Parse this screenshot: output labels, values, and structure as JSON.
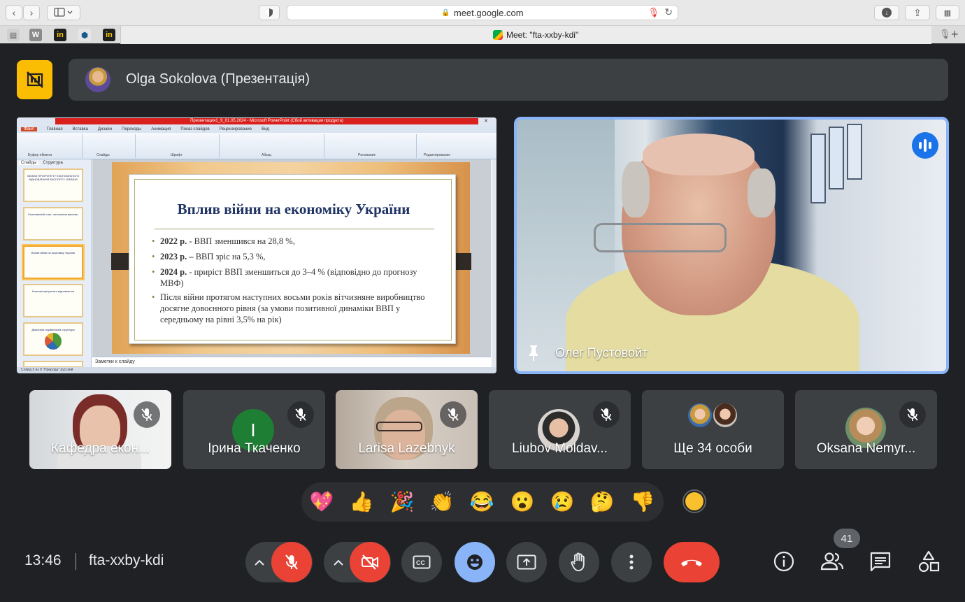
{
  "browser": {
    "url": "meet.google.com",
    "tab_title": "Meet: \"fta-xxby-kdi\""
  },
  "presentation": {
    "presenter_label": "Olga Sokolova (Презентація)",
    "ppt_window_title": "Презентация1_9_01.05.2024 - Microsoft PowerPoint (Сбой активации продукта)",
    "ppt_menu": [
      "Файл",
      "Главная",
      "Вставка",
      "Дизайн",
      "Переходы",
      "Анимация",
      "Показ слайдов",
      "Рецензирование",
      "Вид"
    ],
    "ribbon_groups": [
      "Буфер обмена",
      "Слайды",
      "Шрифт",
      "Абзац",
      "Рисование",
      "Редактирование"
    ],
    "pane_tabs": [
      "Слайды",
      "Структура"
    ],
    "thumbnails": [
      "ОБЛІКИ ПРІОРИТЕТУ ЕКОНОМІЧНОГО ВІДНОВЛЕННЯ ЕКСПОРТУ УКРАЇНИ",
      "Економічний стан і економічні виклики",
      "Вплив війни на економіку України",
      "Ключові пріоритети відновлення",
      "Довоєнна порівняльна структура",
      "Умови пріоритетного відновлення"
    ],
    "slide": {
      "title": "Вплив війни на економіку України",
      "bullets": [
        {
          "bold": "2022 р.",
          "text": " - ВВП зменшився на 28,8 %,"
        },
        {
          "bold": "2023 р. –",
          "text": " ВВП зріс на 5,3 %,"
        },
        {
          "bold": "2024 р.",
          "text": " - приріст ВВП зменшиться до 3–4 % (відповідно до прогнозу МВФ)"
        },
        {
          "bold": "",
          "text": "Після війни протягом наступних восьми років вітчизняне виробництво досягне довоєнного рівня (за умови позитивної динаміки ВВП у середньому на рівні 3,5% на рік)"
        }
      ]
    },
    "notes_placeholder": "Заметки к слайду",
    "status_text": "Слайд 3 из 9   \"Природа\"   русский"
  },
  "speaker": {
    "name": "Олег Пустовойт"
  },
  "participants": [
    {
      "name": "Кафедра екон...",
      "type": "video"
    },
    {
      "name": "Ірина Ткаченко",
      "type": "avatar",
      "initial": "І",
      "color": "#1e7e34"
    },
    {
      "name": "Larisa Lazebnyk",
      "type": "video"
    },
    {
      "name": "Liubov Moldav...",
      "type": "photo"
    },
    {
      "name": "Ще 34 особи",
      "type": "group"
    },
    {
      "name": "Oksana Nemyr...",
      "type": "photo"
    }
  ],
  "reactions": [
    "💖",
    "👍",
    "🎉",
    "👏",
    "😂",
    "😮",
    "😢",
    "🤔",
    "👎"
  ],
  "bottom_bar": {
    "time": "13:46",
    "meeting_code": "fta-xxby-kdi",
    "participant_count": "41"
  },
  "colors": {
    "present_icon_bg": "#fbbc04",
    "danger": "#ea4335",
    "accent_blue": "#8ab4f8",
    "meet_bg": "#202124"
  }
}
